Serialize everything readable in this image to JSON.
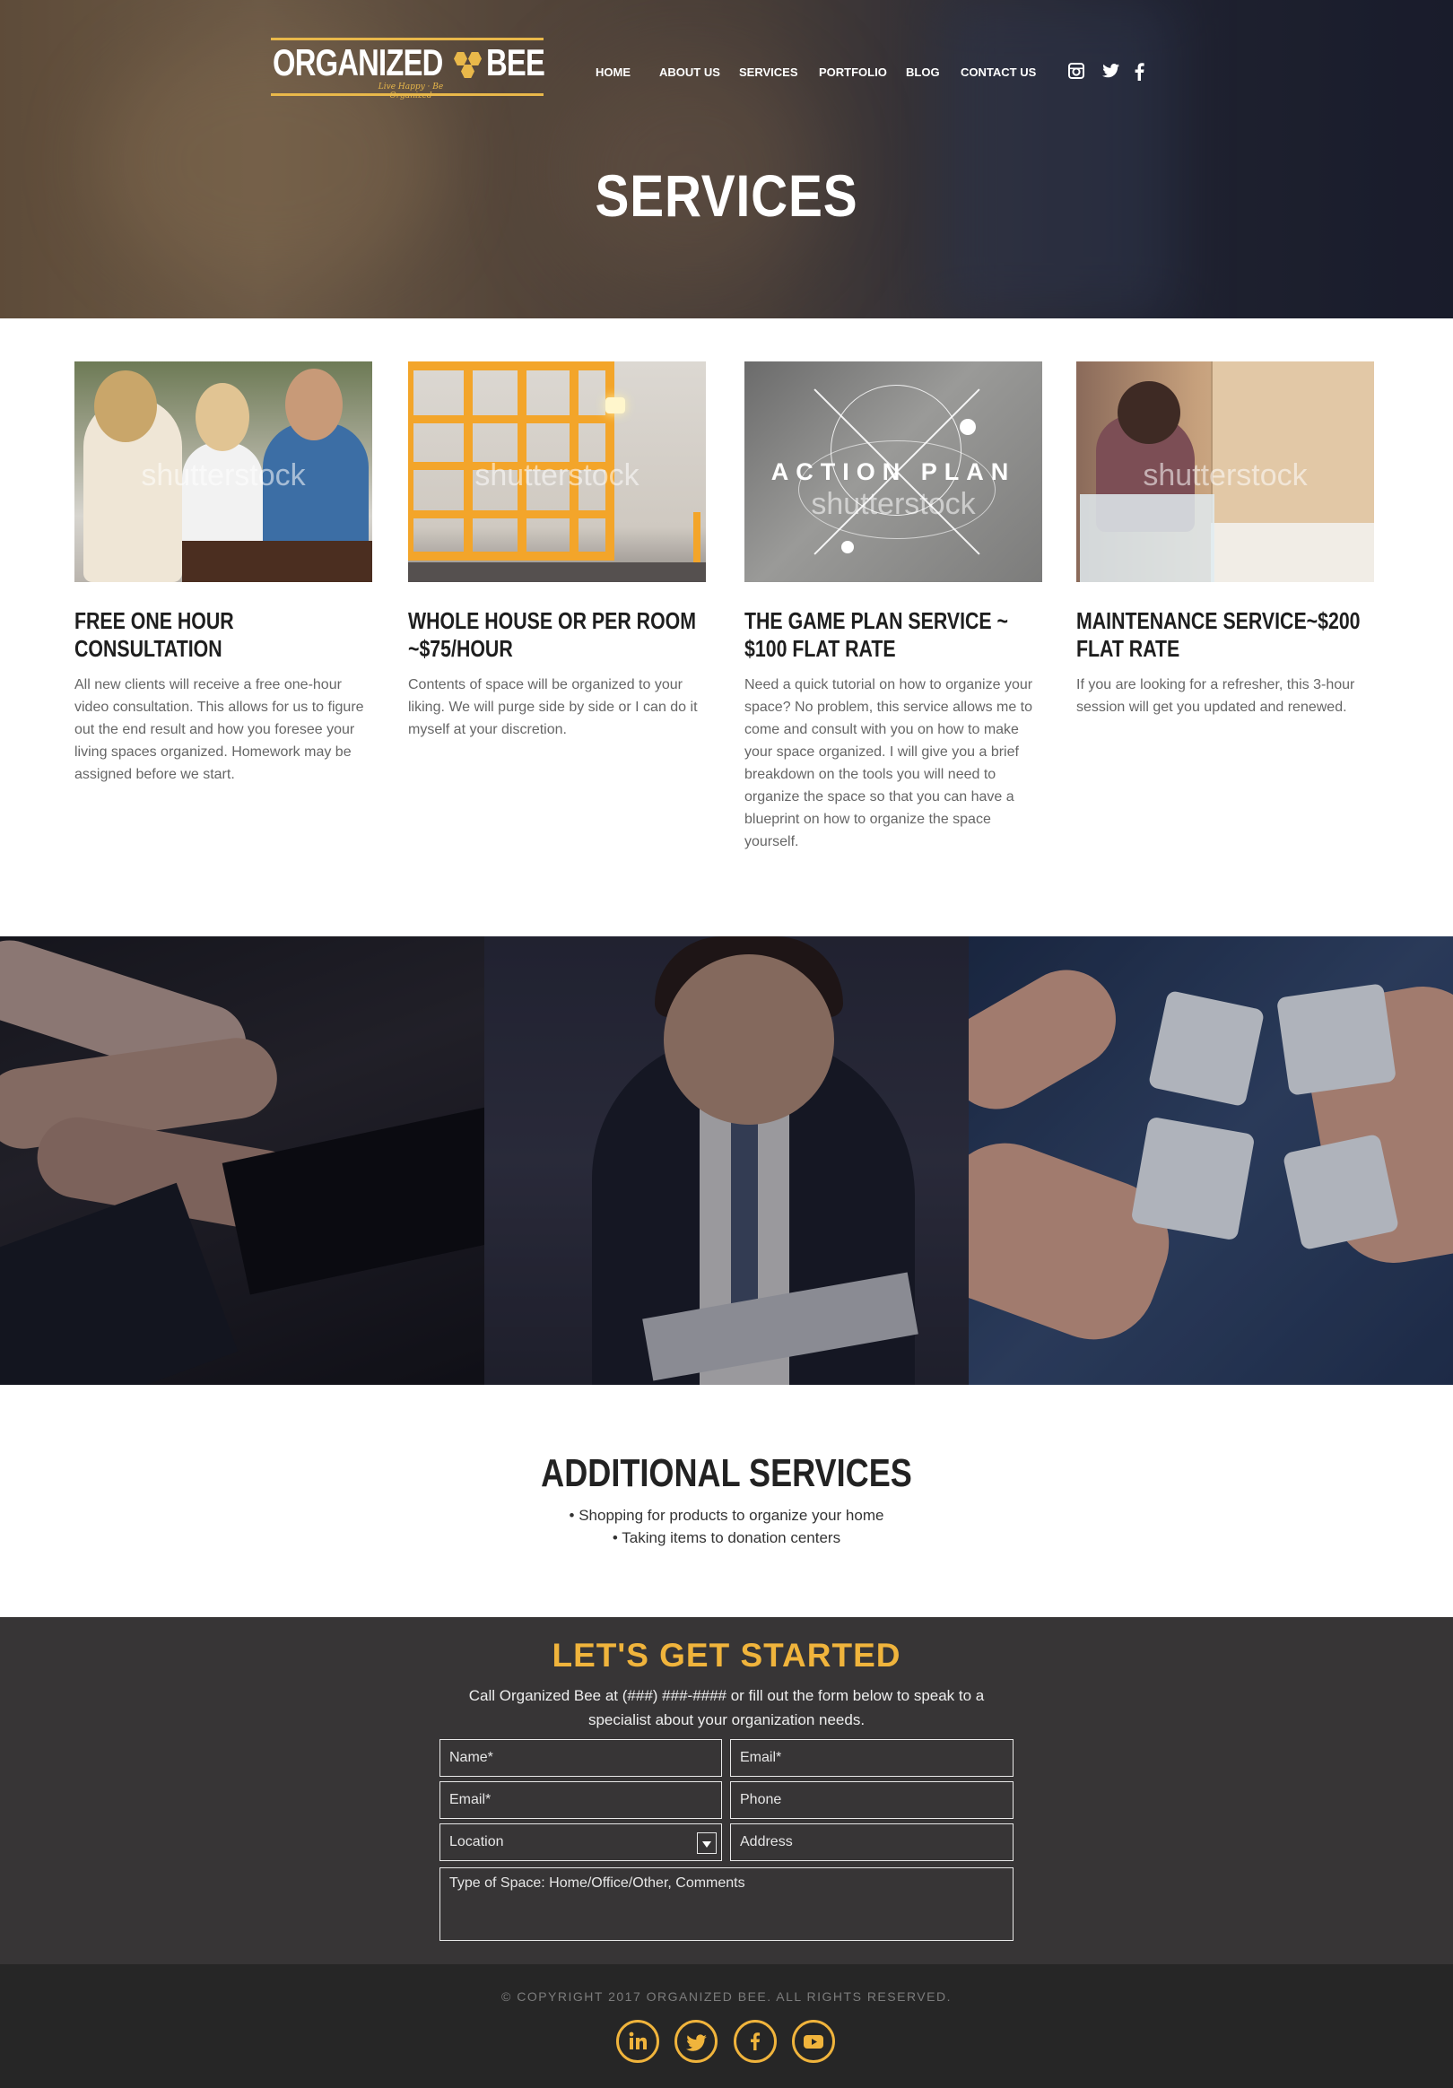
{
  "brand": {
    "name_part1": "ORGANIZED",
    "name_part2": "BEE",
    "tagline": "Live Happy · Be Organized",
    "accent_color": "#f0b43c"
  },
  "nav": {
    "items": [
      "HOME",
      "ABOUT US",
      "SERVICES",
      "PORTFOLIO",
      "BLOG",
      "CONTACT US"
    ],
    "social": [
      "instagram-icon",
      "twitter-icon",
      "facebook-icon"
    ]
  },
  "hero": {
    "title": "SERVICES"
  },
  "services": [
    {
      "image_watermark": "shutterstock",
      "title": "FREE ONE HOUR CONSULTATION",
      "text": "All new clients will receive a free one-hour video consultation. This allows for us to figure out the end result and how you foresee your living spaces organized. Homework may be assigned before we start."
    },
    {
      "image_watermark": "shutterstock",
      "title": "WHOLE HOUSE OR PER ROOM ~$75/HOUR",
      "text": "Contents of space will  be organized to your liking. We will purge side by side or I can do it myself at your discretion."
    },
    {
      "image_watermark": "shutterstock",
      "image_caption": "ACTION PLAN",
      "title": "THE GAME PLAN SERVICE ~ $100 FLAT RATE",
      "text": "Need a quick tutorial on how to organize your space? No problem, this service allows me to come and consult with you on how to make your space organized. I will give you a brief breakdown on the tools you will need to organize the space so that you can have a blueprint on how to organize the space yourself."
    },
    {
      "image_watermark": "shutterstock",
      "title": "MAINTENANCE SERVICE~$200 FLAT RATE",
      "text": "If you are looking for a refresher, this 3-hour session will get you updated and renewed."
    }
  ],
  "additional": {
    "title": "ADDITIONAL SERVICES",
    "items": [
      "• Shopping for products to organize your home",
      "• Taking items to donation centers"
    ]
  },
  "contact": {
    "title": "LET'S GET STARTED",
    "subtitle": "Call Organized Bee at (###) ###-#### or fill out the form below to speak to a specialist about your organization needs.",
    "fields": {
      "name": "Name*",
      "email1": "Email*",
      "email2": "Email*",
      "phone": "Phone",
      "location": "Location",
      "address": "Address",
      "comments": "Type of Space: Home/Office/Other, Comments"
    }
  },
  "footer": {
    "copyright": "© COPYRIGHT 2017 ORGANIZED BEE. ALL RIGHTS RESERVED.",
    "social": [
      "linkedin-icon",
      "twitter-icon",
      "facebook-icon",
      "youtube-icon"
    ]
  }
}
